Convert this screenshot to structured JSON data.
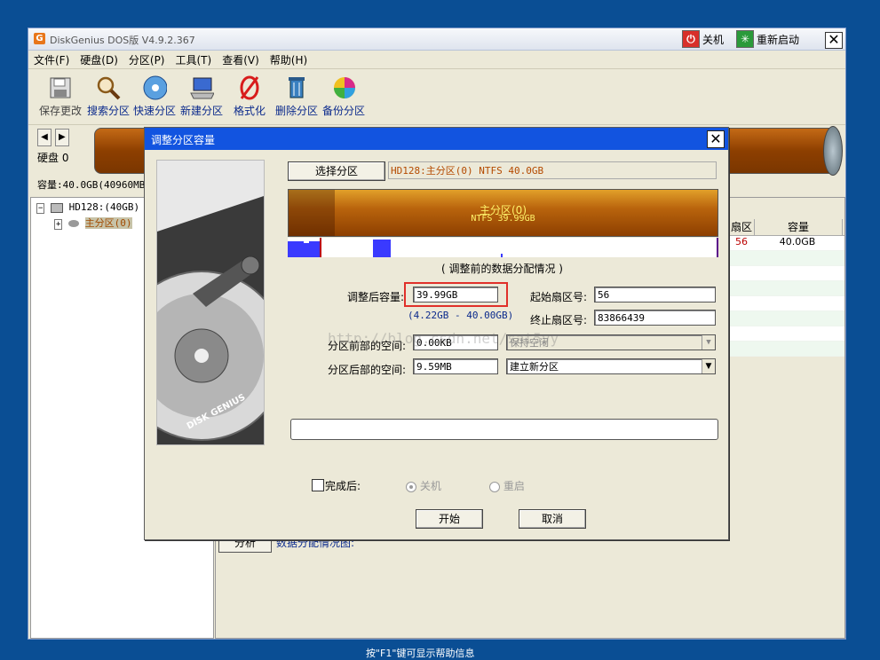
{
  "app": {
    "title": "DiskGenius DOS版 V4.9.2.367",
    "logo_letter": "G",
    "shutdown_label": "关机",
    "restart_label": "重新启动",
    "close_glyph": "✕"
  },
  "menu": [
    "文件(F)",
    "硬盘(D)",
    "分区(P)",
    "工具(T)",
    "查看(V)",
    "帮助(H)"
  ],
  "toolbar": {
    "save": "保存更改",
    "search": "搜索分区",
    "quick": "快速分区",
    "new": "新建分区",
    "format": "格式化",
    "delete": "删除分区",
    "backup": "备份分区"
  },
  "disk": {
    "label": "硬盘 0",
    "capacity_line": "容量:40.0GB(40960MB)"
  },
  "tree": {
    "disk": "HD128:(40GB)",
    "partition": "主分区(0)"
  },
  "grid": {
    "headers": [
      "扇区",
      "容量"
    ],
    "rows": [
      [
        "56",
        "40.0GB"
      ]
    ]
  },
  "analysis": {
    "button": "分析",
    "label": "数据分配情况图:"
  },
  "status_text": "按\"F1\"键可显示帮助信息",
  "dialog": {
    "title": "调整分区容量",
    "select_button": "选择分区",
    "selected_partition": "HD128:主分区(0) NTFS 40.0GB",
    "bar_line1": "主分区(0)",
    "bar_line2": "NTFS 39.99GB",
    "dist_title": "( 调整前的数据分配情况 )",
    "new_size_label": "调整后容量:",
    "new_size_value": "39.99GB",
    "range_hint": "(4.22GB - 40.00GB)",
    "start_sector_label": "起始扇区号:",
    "start_sector_value": "56",
    "end_sector_label": "终止扇区号:",
    "end_sector_value": "83866439",
    "front_space_label": "分区前部的空间:",
    "front_space_value": "0.00KB",
    "front_space_action": "保持空闲",
    "rear_space_label": "分区后部的空间:",
    "rear_space_value": "9.59MB",
    "rear_space_action": "建立新分区",
    "after_label": "完成后:",
    "opt_shutdown": "关机",
    "opt_restart": "重启",
    "start_button": "开始",
    "cancel_button": "取消",
    "watermark": "http://blog.csdn.net/sat5yy",
    "side_brand": "DISK GENIUS"
  },
  "colors": {
    "desktop": "#0a4e94",
    "dialog_title": "#1254e0",
    "partition_bar": "#b9640d",
    "highlight_box": "#e0302a"
  }
}
